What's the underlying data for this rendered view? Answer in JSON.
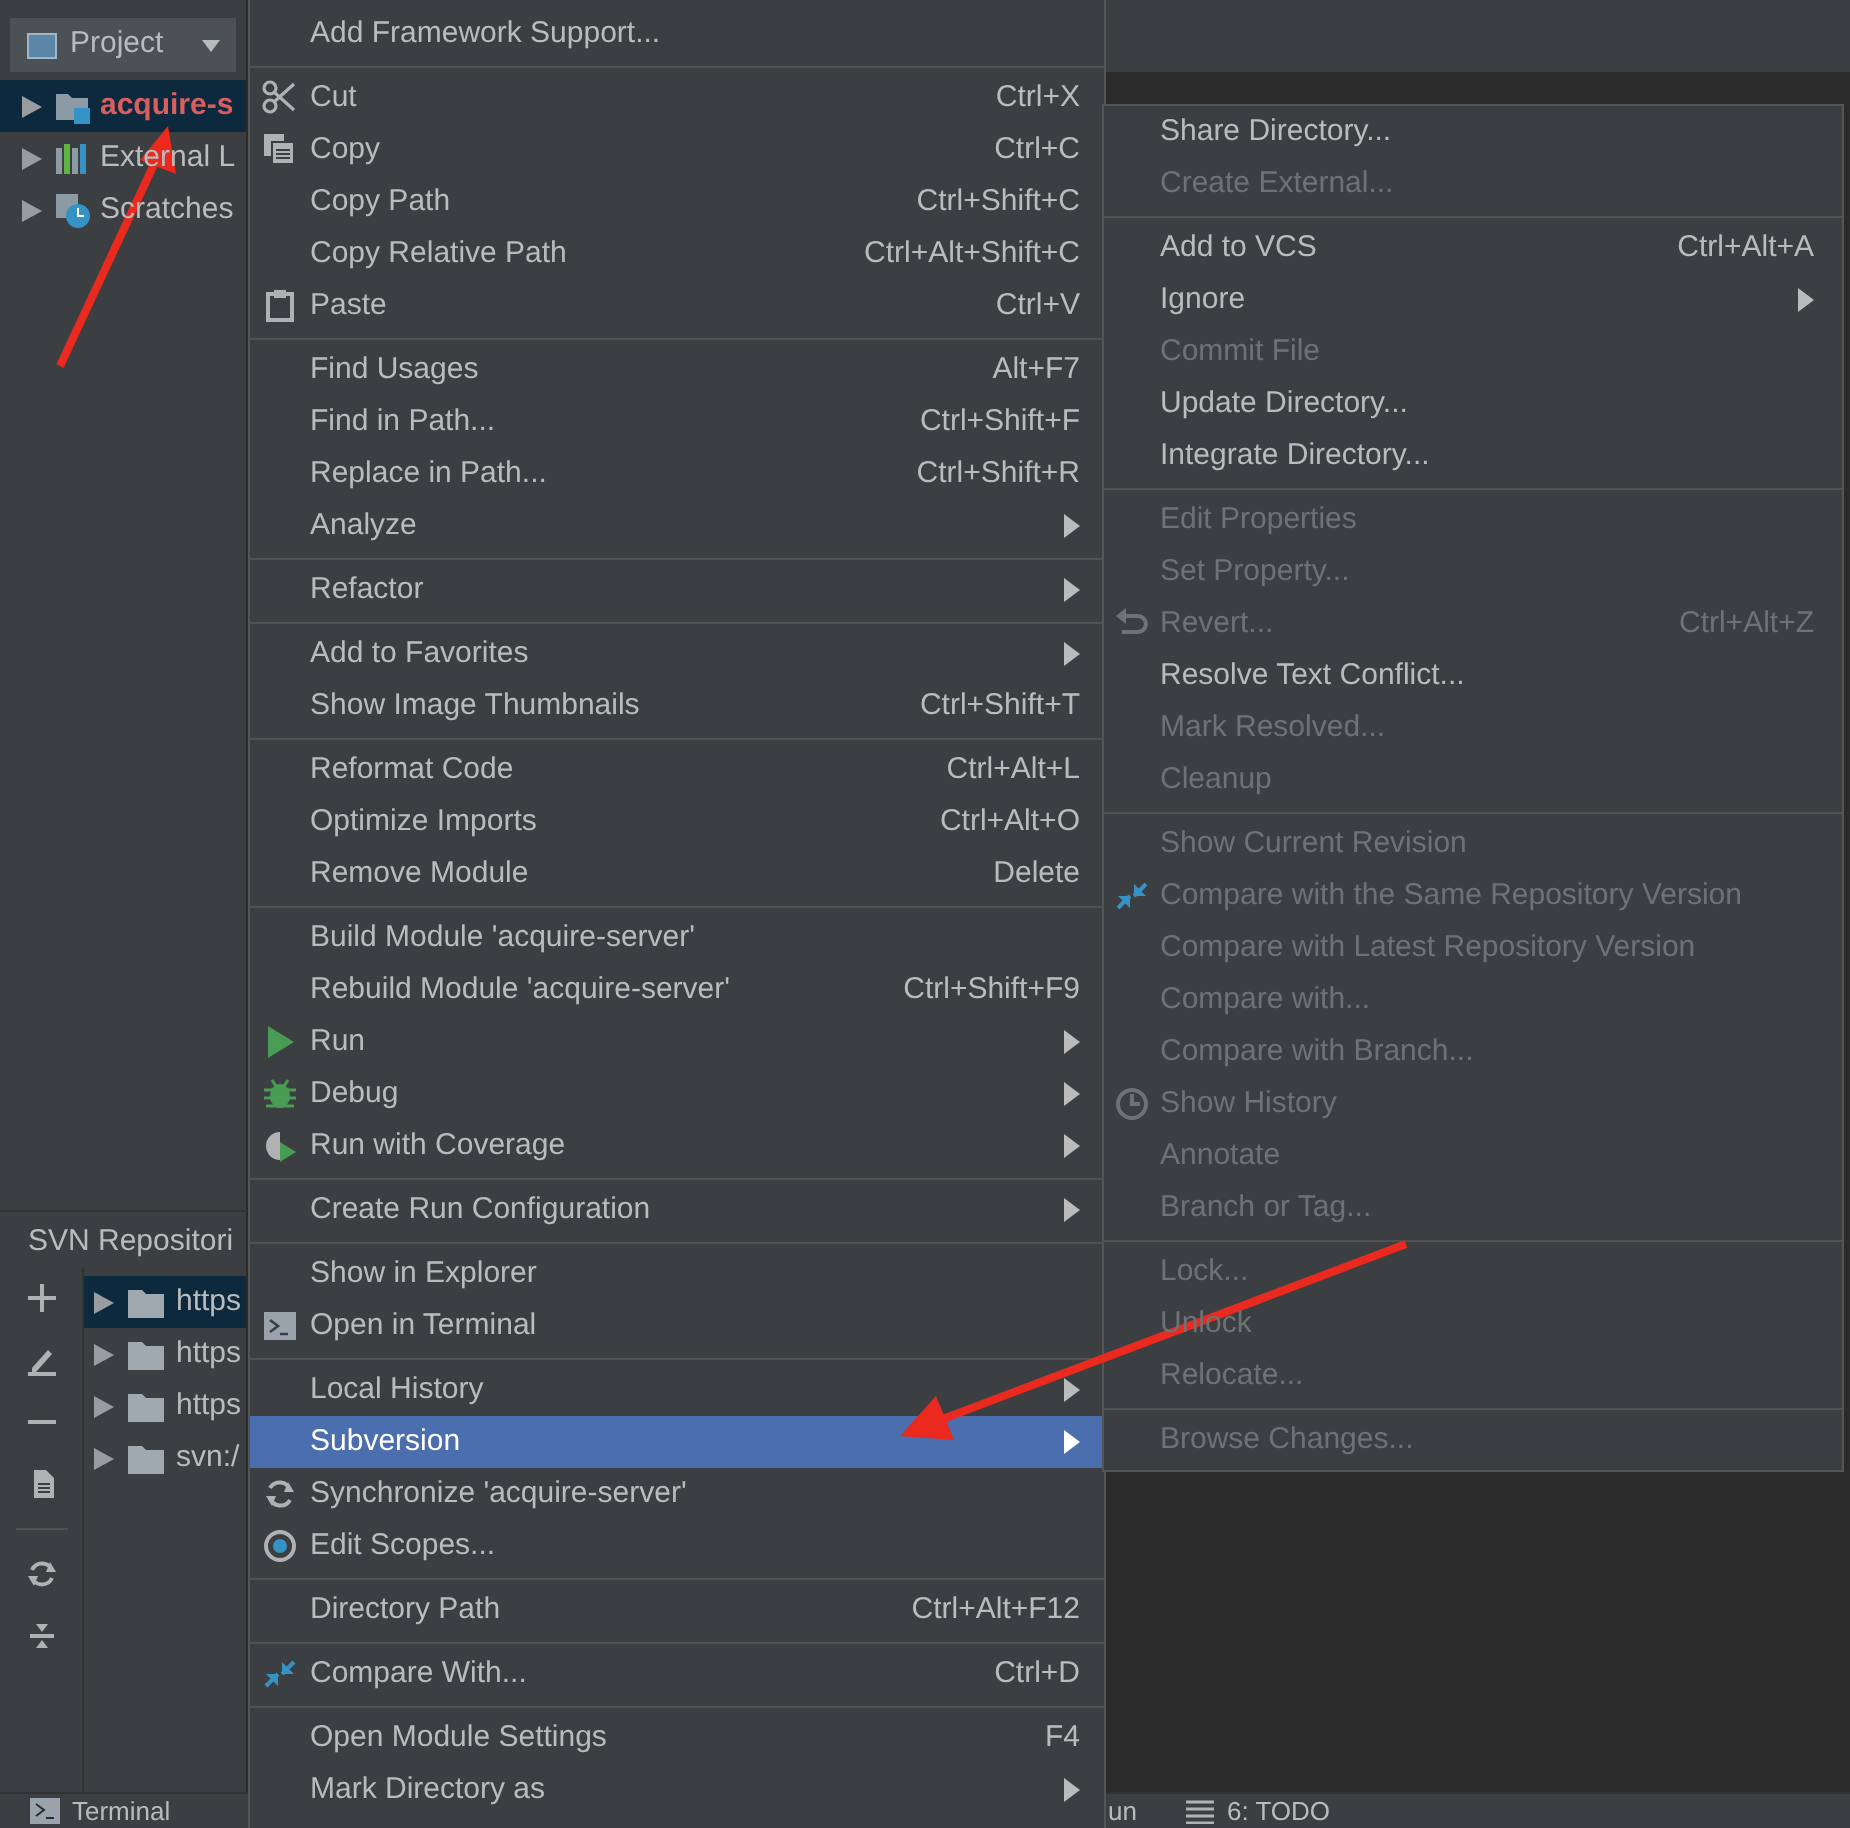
{
  "project_panel": {
    "title": "Project",
    "tree": [
      {
        "label": "acquire-s",
        "kind": "module",
        "selected": true
      },
      {
        "label": "External L",
        "kind": "libraries",
        "selected": false
      },
      {
        "label": "Scratches",
        "kind": "scratches",
        "selected": false
      }
    ]
  },
  "svn_panel": {
    "title": "SVN Repositori",
    "toolbar": [
      {
        "kind": "add"
      },
      {
        "kind": "edit"
      },
      {
        "kind": "remove"
      },
      {
        "kind": "document"
      },
      {
        "kind": "refresh"
      },
      {
        "kind": "collapse"
      }
    ],
    "repositories": [
      {
        "label": "https",
        "selected": true
      },
      {
        "label": "https",
        "selected": false
      },
      {
        "label": "https",
        "selected": false
      },
      {
        "label": "svn:/",
        "selected": false
      }
    ]
  },
  "status_bar": [
    {
      "label": "Terminal",
      "kind": "terminal"
    },
    {
      "label": "un",
      "kind": "plain"
    },
    {
      "label": "6: TODO",
      "kind": "todo"
    }
  ],
  "context_menu": {
    "items": [
      {
        "kind": "item",
        "label": "Add Framework Support...",
        "selected": false
      },
      {
        "kind": "separator"
      },
      {
        "kind": "cut",
        "label": "Cut",
        "shortcut": "Ctrl+X",
        "selected": false
      },
      {
        "kind": "copy",
        "label": "Copy",
        "shortcut": "Ctrl+C",
        "selected": false
      },
      {
        "kind": "item",
        "label": "Copy Path",
        "shortcut": "Ctrl+Shift+C",
        "selected": false
      },
      {
        "kind": "item",
        "label": "Copy Relative Path",
        "shortcut": "Ctrl+Alt+Shift+C",
        "selected": false
      },
      {
        "kind": "paste",
        "label": "Paste",
        "shortcut": "Ctrl+V",
        "selected": false
      },
      {
        "kind": "separator"
      },
      {
        "kind": "item",
        "label": "Find Usages",
        "shortcut": "Alt+F7",
        "selected": false
      },
      {
        "kind": "item",
        "label": "Find in Path...",
        "shortcut": "Ctrl+Shift+F",
        "selected": false
      },
      {
        "kind": "item",
        "label": "Replace in Path...",
        "shortcut": "Ctrl+Shift+R",
        "selected": false
      },
      {
        "kind": "item",
        "label": "Analyze",
        "submenu": true,
        "selected": false
      },
      {
        "kind": "separator"
      },
      {
        "kind": "item",
        "label": "Refactor",
        "submenu": true,
        "selected": false
      },
      {
        "kind": "separator"
      },
      {
        "kind": "item",
        "label": "Add to Favorites",
        "submenu": true,
        "selected": false
      },
      {
        "kind": "item",
        "label": "Show Image Thumbnails",
        "shortcut": "Ctrl+Shift+T",
        "selected": false
      },
      {
        "kind": "separator"
      },
      {
        "kind": "item",
        "label": "Reformat Code",
        "shortcut": "Ctrl+Alt+L",
        "selected": false
      },
      {
        "kind": "item",
        "label": "Optimize Imports",
        "shortcut": "Ctrl+Alt+O",
        "selected": false
      },
      {
        "kind": "item",
        "label": "Remove Module",
        "shortcut": "Delete",
        "selected": false
      },
      {
        "kind": "separator"
      },
      {
        "kind": "item",
        "label": "Build Module 'acquire-server'",
        "selected": false
      },
      {
        "kind": "item",
        "label": "Rebuild Module 'acquire-server'",
        "shortcut": "Ctrl+Shift+F9",
        "selected": false
      },
      {
        "kind": "run",
        "label": "Run",
        "submenu": true,
        "selected": false
      },
      {
        "kind": "debug",
        "label": "Debug",
        "submenu": true,
        "selected": false
      },
      {
        "kind": "coverage",
        "label": "Run with Coverage",
        "submenu": true,
        "selected": false
      },
      {
        "kind": "separator"
      },
      {
        "kind": "item",
        "label": "Create Run Configuration",
        "submenu": true,
        "selected": false
      },
      {
        "kind": "separator"
      },
      {
        "kind": "item",
        "label": "Show in Explorer",
        "selected": false
      },
      {
        "kind": "terminal",
        "label": "Open in Terminal",
        "selected": false
      },
      {
        "kind": "separator"
      },
      {
        "kind": "item",
        "label": "Local History",
        "submenu": true,
        "selected": false
      },
      {
        "kind": "item",
        "label": "Subversion",
        "submenu": true,
        "selected": true
      },
      {
        "kind": "sync",
        "label": "Synchronize 'acquire-server'",
        "selected": false
      },
      {
        "kind": "scopes",
        "label": "Edit Scopes...",
        "selected": false
      },
      {
        "kind": "separator"
      },
      {
        "kind": "item",
        "label": "Directory Path",
        "shortcut": "Ctrl+Alt+F12",
        "selected": false
      },
      {
        "kind": "separator"
      },
      {
        "kind": "compare",
        "label": "Compare With...",
        "shortcut": "Ctrl+D",
        "selected": false
      },
      {
        "kind": "separator"
      },
      {
        "kind": "item",
        "label": "Open Module Settings",
        "shortcut": "F4",
        "selected": false
      },
      {
        "kind": "item",
        "label": "Mark Directory as",
        "submenu": true,
        "selected": false
      }
    ]
  },
  "subversion_menu": {
    "items": [
      {
        "kind": "item",
        "label": "Share Directory...",
        "disabled": false
      },
      {
        "kind": "item",
        "label": "Create External...",
        "disabled": true
      },
      {
        "kind": "separator"
      },
      {
        "kind": "item",
        "label": "Add to VCS",
        "shortcut": "Ctrl+Alt+A",
        "disabled": false
      },
      {
        "kind": "item",
        "label": "Ignore",
        "submenu": true,
        "disabled": false
      },
      {
        "kind": "item",
        "label": "Commit File",
        "disabled": true
      },
      {
        "kind": "item",
        "label": "Update Directory...",
        "disabled": false
      },
      {
        "kind": "item",
        "label": "Integrate Directory...",
        "disabled": false
      },
      {
        "kind": "separator"
      },
      {
        "kind": "item",
        "label": "Edit Properties",
        "disabled": true
      },
      {
        "kind": "item",
        "label": "Set Property...",
        "disabled": true
      },
      {
        "kind": "revert",
        "label": "Revert...",
        "shortcut": "Ctrl+Alt+Z",
        "disabled": true
      },
      {
        "kind": "item",
        "label": "Resolve Text Conflict...",
        "disabled": false
      },
      {
        "kind": "item",
        "label": "Mark Resolved...",
        "disabled": true
      },
      {
        "kind": "item",
        "label": "Cleanup",
        "disabled": true
      },
      {
        "kind": "separator"
      },
      {
        "kind": "item",
        "label": "Show Current Revision",
        "disabled": true
      },
      {
        "kind": "compare",
        "label": "Compare with the Same Repository Version",
        "disabled": true
      },
      {
        "kind": "item",
        "label": "Compare with Latest Repository Version",
        "disabled": true
      },
      {
        "kind": "item",
        "label": "Compare with...",
        "disabled": true
      },
      {
        "kind": "item",
        "label": "Compare with Branch...",
        "disabled": true
      },
      {
        "kind": "history",
        "label": "Show History",
        "disabled": true
      },
      {
        "kind": "item",
        "label": "Annotate",
        "disabled": true
      },
      {
        "kind": "item",
        "label": "Branch or Tag...",
        "disabled": true
      },
      {
        "kind": "separator"
      },
      {
        "kind": "item",
        "label": "Lock...",
        "disabled": true
      },
      {
        "kind": "item",
        "label": "Unlock",
        "disabled": true
      },
      {
        "kind": "item",
        "label": "Relocate...",
        "disabled": true
      },
      {
        "kind": "separator"
      },
      {
        "kind": "item",
        "label": "Browse Changes...",
        "disabled": true
      }
    ]
  }
}
